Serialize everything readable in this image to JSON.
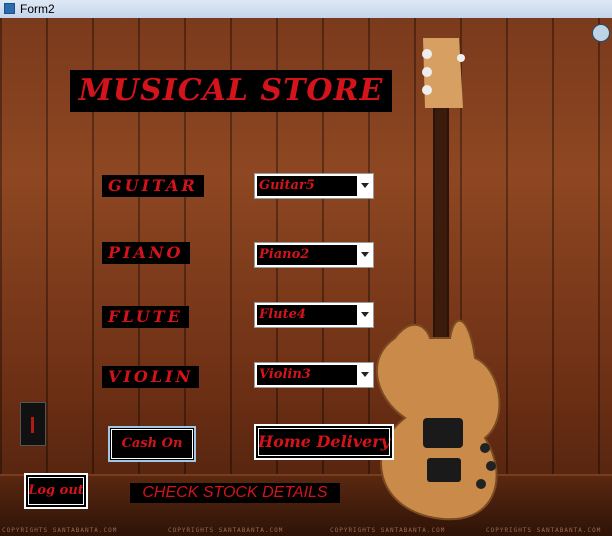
{
  "window": {
    "title": "Form2"
  },
  "store": {
    "title": "MUSICAL STORE"
  },
  "categories": [
    {
      "label": "GUITAR",
      "selected": "Guitar5"
    },
    {
      "label": "PIANO",
      "selected": "Piano2"
    },
    {
      "label": "FLUTE",
      "selected": "Flute4"
    },
    {
      "label": "VIOLIN",
      "selected": "Violin3"
    }
  ],
  "buttons": {
    "cash_on": "Cash On",
    "home_delivery": "Home Delivery",
    "log_out": "Log out",
    "check_stock": "CHECK STOCK DETAILS"
  },
  "watermark": {
    "text": "COPYRIGHTS SANTABANTA.COM"
  },
  "icons": {
    "form_icon": "window-form-icon",
    "avatar": "user-avatar-icon",
    "dropdown": "chevron-down-icon"
  },
  "colors": {
    "accent_text": "#d4141a",
    "label_bg": "#000000"
  }
}
